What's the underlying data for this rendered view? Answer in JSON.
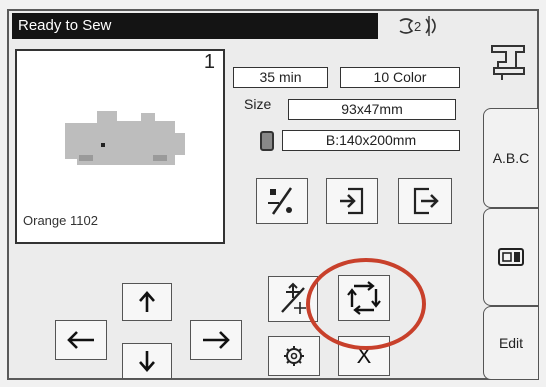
{
  "status": {
    "text": "Ready to Sew"
  },
  "preview": {
    "design_number": "1",
    "thread_color": "Orange 1102"
  },
  "info": {
    "time": "35 min",
    "colors": "10 Color",
    "size_label": "Size",
    "size_value": "93x47mm",
    "hoop_value": "B:140x200mm"
  },
  "tabs": {
    "abc": "A.B.C",
    "edit": "Edit"
  },
  "buttons": {
    "close_label": "X"
  },
  "colors": {
    "highlight": "#c8402b",
    "status_bg": "#141414"
  }
}
